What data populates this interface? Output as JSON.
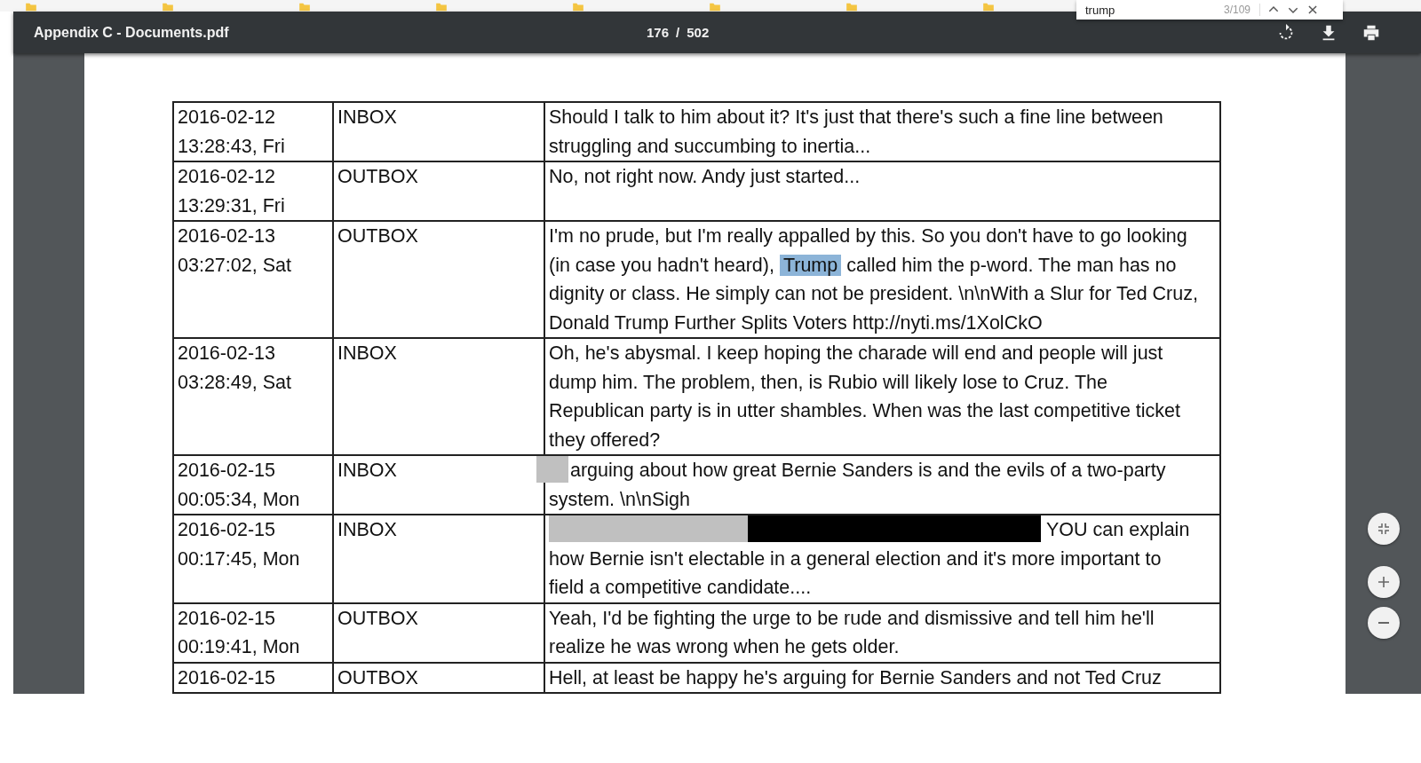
{
  "toolbar": {
    "title": "Appendix C - Documents.pdf",
    "page": "176",
    "separator": "/",
    "total": "502"
  },
  "find_bar": {
    "value": "trump",
    "count": "3/109"
  },
  "table": {
    "rows": [
      {
        "date": "2016-02-12",
        "time": "13:28:43, Fri",
        "box": "INBOX",
        "message": [
          {
            "kind": "text",
            "text": "Should I talk to him about it? It's just that there's such a fine line between struggling and succumbing to inertia..."
          }
        ]
      },
      {
        "date": "2016-02-12",
        "time": "13:29:31, Fri",
        "box": "OUTBOX",
        "message": [
          {
            "kind": "text",
            "text": "No, not right now. Andy just started..."
          }
        ]
      },
      {
        "date": "2016-02-13",
        "time": "03:27:02, Sat",
        "box": "OUTBOX",
        "message": [
          {
            "kind": "text",
            "text": "I'm no prude, but I'm really appalled by this. So you don't have to go looking (in case you hadn't heard),"
          },
          {
            "kind": "match",
            "text": "Trump"
          },
          {
            "kind": "text",
            "text": "called him the p-word. The man has no dignity or class. He simply can not be president. \\n\\nWith a Slur for Ted Cruz, Donald Trump Further Splits Voters http://nyti.ms/1XolCkO"
          }
        ]
      },
      {
        "date": "2016-02-13",
        "time": "03:28:49, Sat",
        "box": "INBOX",
        "message": [
          {
            "kind": "text",
            "text": "Oh, he's abysmal. I keep hoping the charade will end and people will just dump him. The problem, then, is Rubio will likely lose to Cruz. The Republican party is in utter shambles. When was the last competitive ticket they offered?"
          }
        ]
      },
      {
        "date": "2016-02-15",
        "time": "00:05:34, Mon",
        "box": "INBOX",
        "message": [
          {
            "kind": "stub",
            "color": "#c0c0c0"
          },
          {
            "kind": "text",
            "text": "arguing about how great Bernie Sanders is and the evils of a two-party system. \\n\\nSigh"
          }
        ]
      },
      {
        "date": "2016-02-15",
        "time": "00:17:45, Mon",
        "box": "INBOX",
        "message": [
          {
            "kind": "bar",
            "color": "#c0c0c0"
          },
          {
            "kind": "block",
            "color": "#000000"
          },
          {
            "kind": "text",
            "text": "YOU can explain how Bernie isn't electable in a general election and it's more important to field a competitive candidate...."
          }
        ]
      },
      {
        "date": "2016-02-15",
        "time": "00:19:41, Mon",
        "box": "OUTBOX",
        "message": [
          {
            "kind": "text",
            "text": "Yeah, I'd be fighting the urge to be rude and dismissive and tell him he'll realize he was wrong when he gets older."
          }
        ]
      },
      {
        "date": "2016-02-15",
        "box": "OUTBOX",
        "message": [
          {
            "kind": "text",
            "text": "Hell, at least be happy he's arguing for Bernie Sanders and not Ted Cruz"
          }
        ]
      }
    ]
  }
}
